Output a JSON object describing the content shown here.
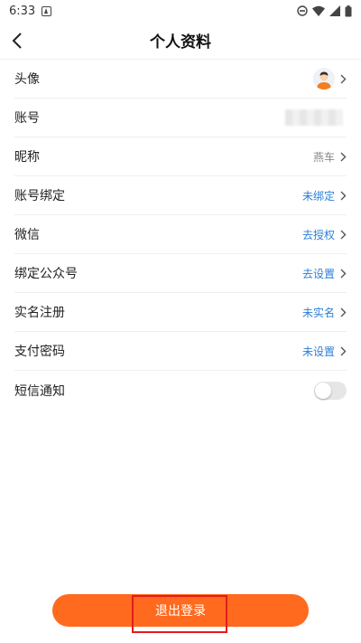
{
  "status_bar": {
    "time": "6:33",
    "icons": [
      "a-notification-icon",
      "do-not-disturb-icon",
      "wifi-icon",
      "signal-icon",
      "battery-icon"
    ]
  },
  "header": {
    "title": "个人资料",
    "back_icon": "chevron-left-icon"
  },
  "profile": {
    "avatar_row": {
      "label": "头像"
    },
    "account_row": {
      "label": "账号"
    },
    "nickname_row": {
      "label": "昵称",
      "value": "燕车"
    },
    "binding_row": {
      "label": "账号绑定",
      "value": "未绑定"
    },
    "wechat_row": {
      "label": "微信",
      "value": "去授权"
    },
    "official_account_row": {
      "label": "绑定公众号",
      "value": "去设置"
    },
    "realname_row": {
      "label": "实名注册",
      "value": "未实名"
    },
    "paypwd_row": {
      "label": "支付密码",
      "value": "未设置"
    },
    "sms_row": {
      "label": "短信通知",
      "toggle_on": false
    }
  },
  "footer": {
    "logout_label": "退出登录"
  },
  "colors": {
    "accent": "#ff6a1f",
    "link": "#2b7fd6",
    "highlight": "#e31b1b"
  }
}
